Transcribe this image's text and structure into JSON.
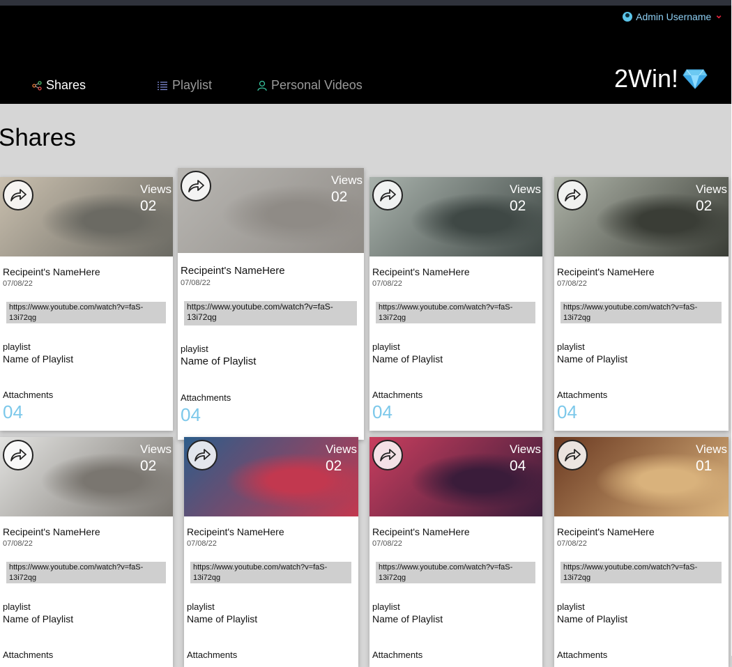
{
  "header": {
    "user": "Admin Username",
    "brand": "2Win!",
    "nav": [
      {
        "label": "Shares",
        "active": true
      },
      {
        "label": "Playlist",
        "active": false
      },
      {
        "label": "Personal Videos",
        "active": false
      }
    ]
  },
  "page_title": "Shares",
  "cards": [
    {
      "views_label": "Views",
      "views": "02",
      "name": "Recipeint's NameHere",
      "date": "07/08/22",
      "url": "https://www.youtube.com/watch?v=faS-13i72qg",
      "playlist_label": "playlist",
      "playlist_name": "Name of Playlist",
      "attachments_label": "Attachments",
      "attachments": "04",
      "thumb_colors": [
        "#c9bfae",
        "#6b6a63"
      ]
    },
    {
      "views_label": "Views",
      "views": "02",
      "name": "Recipeint's NameHere",
      "date": "07/08/22",
      "url": "https://www.youtube.com/watch?v=faS-13i72qg",
      "playlist_label": "playlist",
      "playlist_name": "Name of Playlist",
      "attachments_label": "Attachments",
      "attachments": "04",
      "thumb_colors": [
        "#b9b7b3",
        "#8f8b86"
      ]
    },
    {
      "views_label": "Views",
      "views": "02",
      "name": "Recipeint's NameHere",
      "date": "07/08/22",
      "url": "https://www.youtube.com/watch?v=faS-13i72qg",
      "playlist_label": "playlist",
      "playlist_name": "Name of Playlist",
      "attachments_label": "Attachments",
      "attachments": "04",
      "thumb_colors": [
        "#a9b2ac",
        "#3f4845"
      ]
    },
    {
      "views_label": "Views",
      "views": "02",
      "name": "Recipeint's NameHere",
      "date": "07/08/22",
      "url": "https://www.youtube.com/watch?v=faS-13i72qg",
      "playlist_label": "playlist",
      "playlist_name": "Name of Playlist",
      "attachments_label": "Attachments",
      "attachments": "04",
      "thumb_colors": [
        "#aeb3a8",
        "#3a3d36"
      ]
    },
    {
      "views_label": "Views",
      "views": "02",
      "name": "Recipeint's NameHere",
      "date": "07/08/22",
      "url": "https://www.youtube.com/watch?v=faS-13i72qg",
      "playlist_label": "playlist",
      "playlist_name": "Name of Playlist",
      "attachments_label": "Attachments",
      "attachments": "",
      "thumb_colors": [
        "#e2e2e0",
        "#7a7670"
      ]
    },
    {
      "views_label": "Views",
      "views": "02",
      "name": "Recipeint's NameHere",
      "date": "07/08/22",
      "url": "https://www.youtube.com/watch?v=faS-13i72qg",
      "playlist_label": "playlist",
      "playlist_name": "Name of Playlist",
      "attachments_label": "Attachments",
      "attachments": "",
      "thumb_colors": [
        "#2d5d8a",
        "#c2384f"
      ]
    },
    {
      "views_label": "Views",
      "views": "04",
      "name": "Recipeint's NameHere",
      "date": "07/08/22",
      "url": "https://www.youtube.com/watch?v=faS-13i72qg",
      "playlist_label": "playlist",
      "playlist_name": "Name of Playlist",
      "attachments_label": "Attachments",
      "attachments": "",
      "thumb_colors": [
        "#c83e5e",
        "#3a1c3a"
      ]
    },
    {
      "views_label": "Views",
      "views": "01",
      "name": "Recipeint's NameHere",
      "date": "07/08/22",
      "url": "https://www.youtube.com/watch?v=faS-13i72qg",
      "playlist_label": "playlist",
      "playlist_name": "Name of Playlist",
      "attachments_label": "Attachments",
      "attachments": "",
      "thumb_colors": [
        "#6b3a22",
        "#d9b27c"
      ]
    }
  ]
}
